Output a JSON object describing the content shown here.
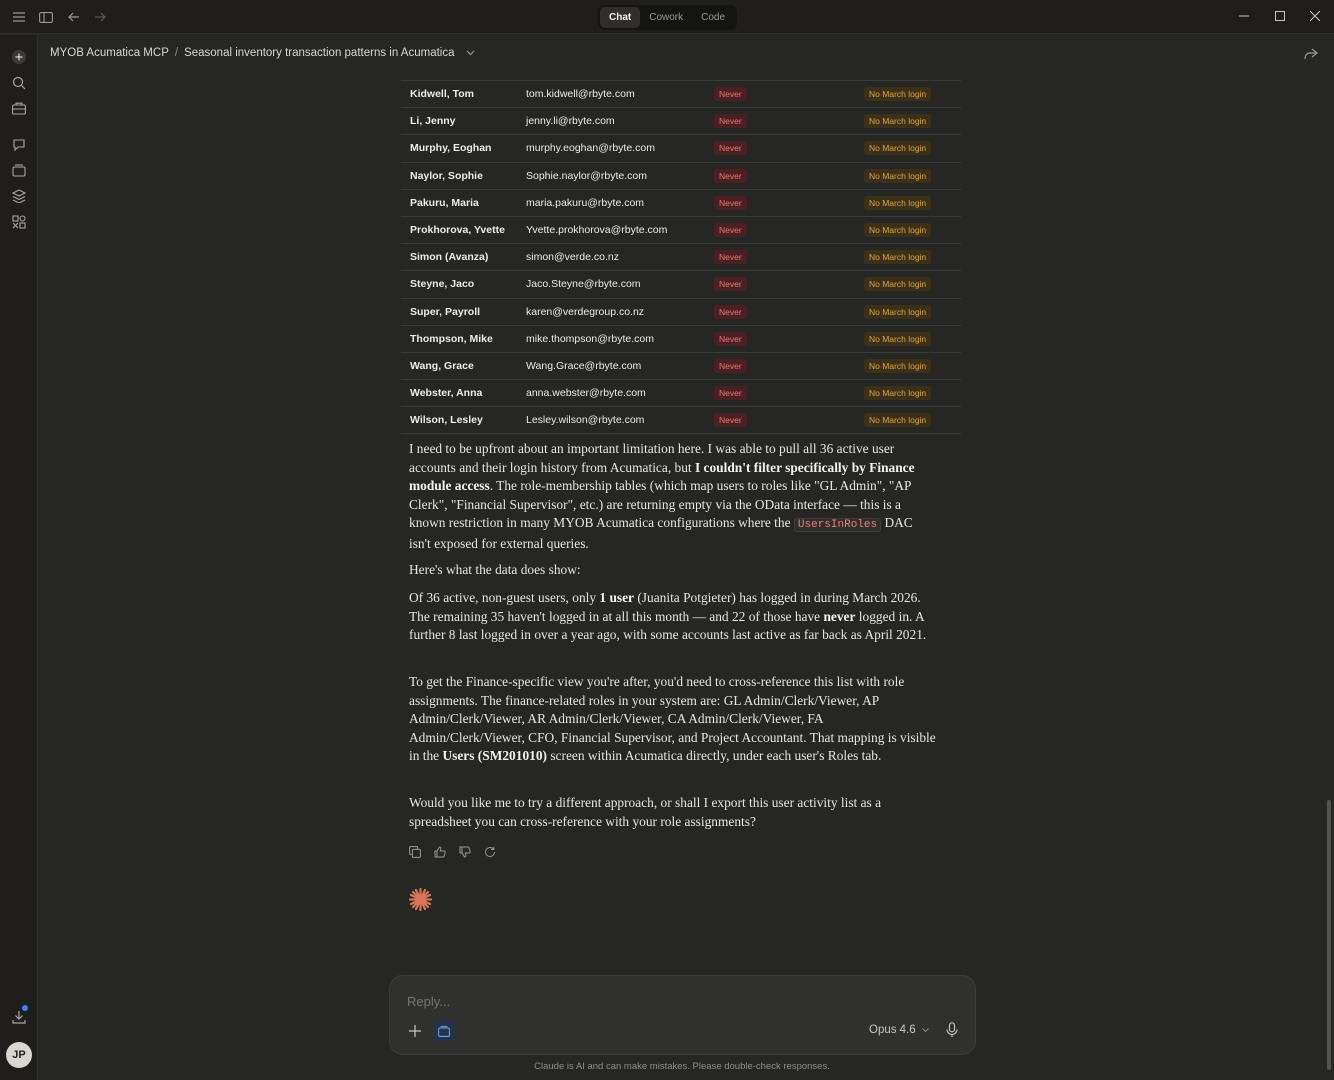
{
  "titlebar": {
    "tabs": [
      "Chat",
      "Cowork",
      "Code"
    ],
    "active_tab": "Chat"
  },
  "breadcrumb": {
    "project": "MYOB Acumatica MCP",
    "separator": "/",
    "conversation": "Seasonal inventory transaction patterns in Acumatica"
  },
  "table": {
    "rows": [
      {
        "name": "Kidwell, Tom",
        "email": "tom.kidwell@rbyte.com",
        "last_login": "Never",
        "status": "No March login"
      },
      {
        "name": "Li, Jenny",
        "email": "jenny.li@rbyte.com",
        "last_login": "Never",
        "status": "No March login"
      },
      {
        "name": "Murphy, Eoghan",
        "email": "murphy.eoghan@rbyte.com",
        "last_login": "Never",
        "status": "No March login"
      },
      {
        "name": "Naylor, Sophie",
        "email": "Sophie.naylor@rbyte.com",
        "last_login": "Never",
        "status": "No March login"
      },
      {
        "name": "Pakuru, Maria",
        "email": "maria.pakuru@rbyte.com",
        "last_login": "Never",
        "status": "No March login"
      },
      {
        "name": "Prokhorova, Yvette",
        "email": "Yvette.prokhorova@rbyte.com",
        "last_login": "Never",
        "status": "No March login"
      },
      {
        "name": "Simon (Avanza)",
        "email": "simon@verde.co.nz",
        "last_login": "Never",
        "status": "No March login"
      },
      {
        "name": "Steyne, Jaco",
        "email": "Jaco.Steyne@rbyte.com",
        "last_login": "Never",
        "status": "No March login"
      },
      {
        "name": "Super, Payroll",
        "email": "karen@verdegroup.co.nz",
        "last_login": "Never",
        "status": "No March login"
      },
      {
        "name": "Thompson, Mike",
        "email": "mike.thompson@rbyte.com",
        "last_login": "Never",
        "status": "No March login"
      },
      {
        "name": "Wang, Grace",
        "email": "Wang.Grace@rbyte.com",
        "last_login": "Never",
        "status": "No March login"
      },
      {
        "name": "Webster, Anna",
        "email": "anna.webster@rbyte.com",
        "last_login": "Never",
        "status": "No March login"
      },
      {
        "name": "Wilson, Lesley",
        "email": "Lesley.wilson@rbyte.com",
        "last_login": "Never",
        "status": "No March login"
      }
    ]
  },
  "message": {
    "p1_a": "I need to be upfront about an important limitation here. I was able to pull all 36 active user accounts and their login history from Acumatica, but ",
    "p1_b": "I couldn't filter specifically by Finance module access",
    "p1_c": ". The role-membership tables (which map users to roles like \"GL Admin\", \"AP Clerk\", \"Financial Supervisor\", etc.) are returning empty via the OData interface — this is a known restriction in many MYOB Acumatica configurations where the ",
    "p1_code": "UsersInRoles",
    "p1_d": " DAC isn't exposed for external queries.",
    "p2": "Here's what the data does show:",
    "p3_a": "Of 36 active, non-guest users, only ",
    "p3_b": "1 user",
    "p3_c": " (Juanita Potgieter) has logged in during March 2026. The remaining 35 haven't logged in at all this month — and 22 of those have ",
    "p3_d": "never",
    "p3_e": " logged in. A further 8 last logged in over a year ago, with some accounts last active as far back as April 2021.",
    "p4_a": "To get the Finance-specific view you're after, you'd need to cross-reference this list with role assignments. The finance-related roles in your system are: GL Admin/Clerk/Viewer, AP Admin/Clerk/Viewer, AR Admin/Clerk/Viewer, CA Admin/Clerk/Viewer, FA Admin/Clerk/Viewer, CFO, Financial Supervisor, and Project Accountant. That mapping is visible in the ",
    "p4_b": "Users (SM201010)",
    "p4_c": " screen within Acumatica directly, under each user's Roles tab.",
    "p5": "Would you like me to try a different approach, or shall I export this user activity list as a spreadsheet you can cross-reference with your role assignments?"
  },
  "composer": {
    "placeholder": "Reply...",
    "model": "Opus 4.6"
  },
  "avatar_initials": "JP",
  "disclaimer": "Claude is AI and can make mistakes. Please double-check responses.",
  "colors": {
    "never_badge": "#e87a70",
    "status_badge": "#d6a54a",
    "claude_accent": "#d97757",
    "code": "#e8807a"
  }
}
